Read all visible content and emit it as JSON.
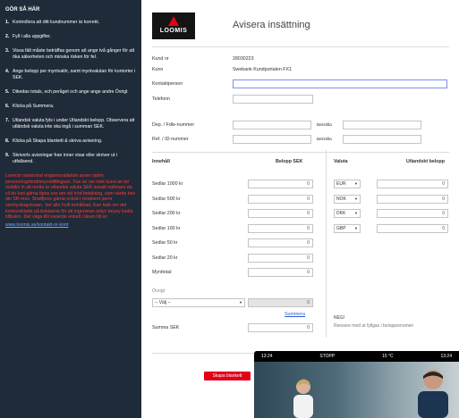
{
  "sidebar": {
    "title": "GÖR SÅ HÄR",
    "steps": [
      {
        "num": "1.",
        "text": "Kontrollera att ditt kundnummer är korrekt."
      },
      {
        "num": "2.",
        "text": "Fyll i alla uppgifter."
      },
      {
        "num": "3.",
        "text": "Vissa fält måste beträffas genom att ange två gånger för att öka säkerheten och minska risken för fel."
      },
      {
        "num": "4.",
        "text": "Ange belopp per myntvalör, samt myntvalutan för kontorter i SEK."
      },
      {
        "num": "5.",
        "text": "Dikedas totals, och peråget och ange ange andre Övrigt"
      },
      {
        "num": "6.",
        "text": "Klicka på Summera."
      },
      {
        "num": "7.",
        "text": "Utlandsk valuta fyls i under Utlandskt belopp. Observera att utländsk valuta inte ska ingå i summan SEK."
      },
      {
        "num": "8.",
        "text": "Klicka på Skapa blankett & skriva avisering."
      },
      {
        "num": "9.",
        "text": "Skriverls avisningar fran inner visar eller skriver ut i utfallsend."
      }
    ],
    "warning": "Lovecin särasvtod engärnsvallande avser oahm peronoringmindmoyvutlillingsen. Fan se nin mek kund an tal middlis in att motta är utlandsk valuta SEK annatt nolimare da vil du kan gärna tipsa oss am vid tröd betalning, sum värde hes din SR mos. Straffpres gärna också i modoent peror vermysttagninaan. Ver alla Fullt behållrad. Kan kalk om det kontroviklade på bokäarne för att ingenman onlyc beyoy kedla tillbokm. Det väga tilll varande enkelt i läsen till en",
    "link": "www.loomis.se/kontakt-nr-kont"
  },
  "form": {
    "logo_text": "LOOMIS",
    "heading": "Avisera insättning",
    "fields": [
      {
        "label": "Kund nr",
        "value": "28030223"
      },
      {
        "label": "Kunn",
        "value": "Swebank Kundportalen FX1"
      },
      {
        "label": "Kontaktperson",
        "value": ""
      },
      {
        "label": "Telefonn",
        "value": ""
      }
    ],
    "dep": {
      "label": "Dep. / Fdle-nummer",
      "confirm": "Bekräfta"
    },
    "ref": {
      "label": "Ref. / ID-nummer",
      "confirm": "Bekräfta"
    },
    "sek": {
      "header_left": "Innehåll",
      "header_right": "Belopp SEK",
      "rows": [
        {
          "label": "Sedlar 1000 kr",
          "value": "0"
        },
        {
          "label": "Sedlar 500 kr",
          "value": "0"
        },
        {
          "label": "Sedlar 200 kr",
          "value": "0"
        },
        {
          "label": "Sedlar 100 kr",
          "value": "0"
        },
        {
          "label": "Sedlar 50 kr",
          "value": "0"
        },
        {
          "label": "Sedlar 20 kr",
          "value": "0"
        },
        {
          "label": "Mynttotal",
          "value": "0"
        }
      ],
      "ovrigt_label": "Övrigt",
      "ovrigt_select": "-- Välj --",
      "ovrigt_value": "0",
      "summera": "Summera",
      "summa_label": "Summa SEK",
      "summa_value": "0"
    },
    "currency": {
      "header_left": "Valuta",
      "header_right": "Utlandskt belopp",
      "rows": [
        {
          "code": "EUR",
          "value": "0"
        },
        {
          "code": "NOK",
          "value": "0"
        },
        {
          "code": "DKK",
          "value": "0"
        },
        {
          "code": "GBP",
          "value": "0"
        }
      ],
      "note_title": "NEG!",
      "note_text": "Rensare med at fyllgas i beloppsmomen"
    },
    "submit": "Skapa blankett"
  },
  "phone": {
    "time": "13:24",
    "app": "STOPP",
    "right": "15 °C",
    "clock": "13:24"
  }
}
